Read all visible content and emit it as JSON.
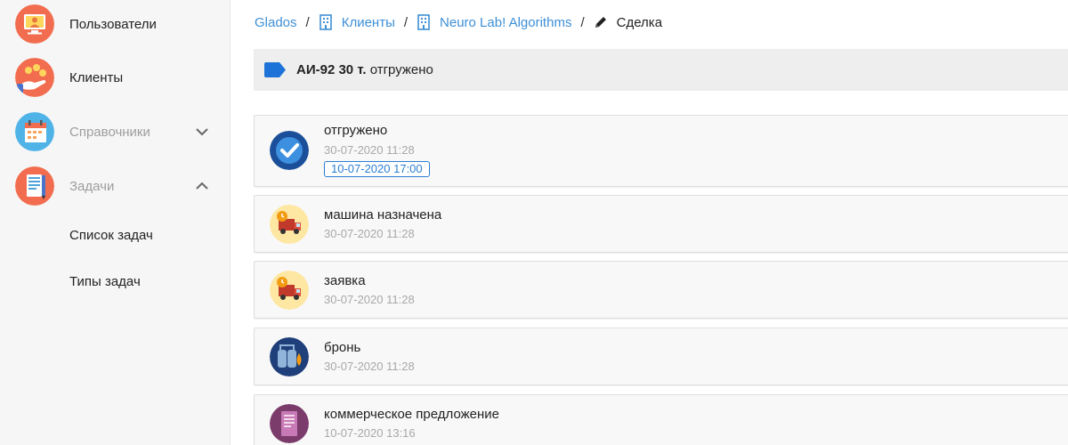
{
  "sidebar": {
    "items": [
      {
        "label": "Пользователи",
        "icon": "users-icon"
      },
      {
        "label": "Клиенты",
        "icon": "clients-icon"
      },
      {
        "label": "Справочники",
        "icon": "directories-icon",
        "expanded": false
      },
      {
        "label": "Задачи",
        "icon": "tasks-icon",
        "expanded": true
      }
    ],
    "subitems": [
      {
        "label": "Список задач"
      },
      {
        "label": "Типы задач"
      }
    ]
  },
  "breadcrumb": {
    "root": "Glados",
    "clients": "Клиенты",
    "company": "Neuro Lab! Algorithms",
    "current": "Сделка"
  },
  "deal": {
    "product": "АИ-92 30 т.",
    "status": "отгружено"
  },
  "timeline": [
    {
      "title": "отгружено",
      "date": "30-07-2020 11:28",
      "badge": "10-07-2020 17:00",
      "icon": "check-icon"
    },
    {
      "title": "машина назначена",
      "date": "30-07-2020 11:28",
      "icon": "truck-icon"
    },
    {
      "title": "заявка",
      "date": "30-07-2020 11:28",
      "icon": "truck-icon"
    },
    {
      "title": "бронь",
      "date": "30-07-2020 11:28",
      "icon": "tanks-icon"
    },
    {
      "title": "коммерческое предложение",
      "date": "10-07-2020 13:16",
      "icon": "document-icon"
    }
  ],
  "colors": {
    "accent": "#3d8fd6",
    "sidebar_bg": "#f6f6f6",
    "deal_bar_bg": "#eeeeee"
  }
}
